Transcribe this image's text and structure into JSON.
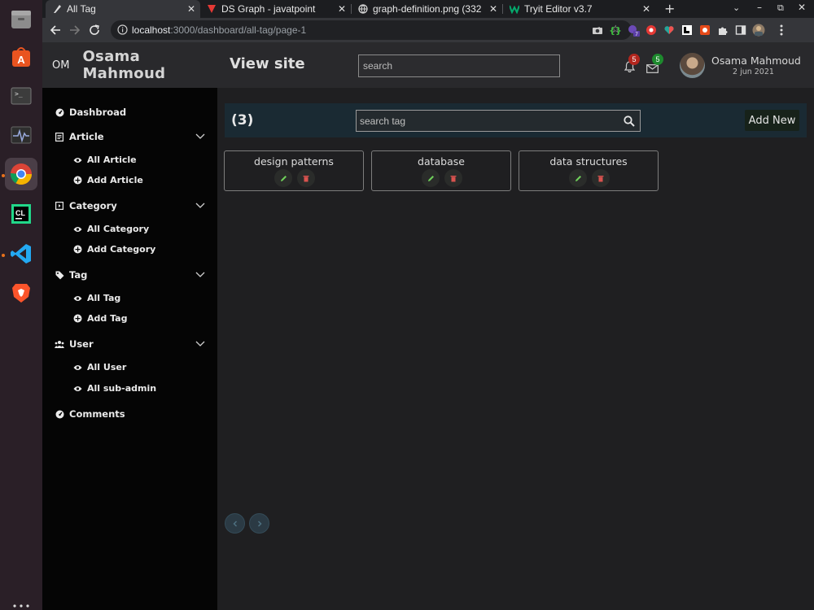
{
  "browser": {
    "tabs": [
      {
        "label": "All Tag",
        "active": true
      },
      {
        "label": "DS Graph - javatpoint",
        "active": false
      },
      {
        "label": "graph-definition.png (332",
        "active": false
      },
      {
        "label": "Tryit Editor v3.7",
        "active": false
      }
    ],
    "url_host": "localhost",
    "url_path": ":3000/dashboard/all-tag/page-1"
  },
  "header": {
    "initials": "OM",
    "brand_name": "Osama Mahmoud",
    "view_site": "View site",
    "search_placeholder": "search",
    "notifications_count": "5",
    "messages_count": "5",
    "user_name": "Osama Mahmoud",
    "user_date": "2 jun 2021"
  },
  "sidebar": {
    "dashboard": "Dashbroad",
    "article": {
      "label": "Article",
      "items": [
        "All Article",
        "Add Article"
      ]
    },
    "category": {
      "label": "Category",
      "items": [
        "All Category",
        "Add Category"
      ]
    },
    "tag": {
      "label": "Tag",
      "items": [
        "All Tag",
        "Add Tag"
      ]
    },
    "user": {
      "label": "User",
      "items": [
        "All User",
        "All sub-admin"
      ]
    },
    "comments": "Comments"
  },
  "main": {
    "count": "(3)",
    "search_placeholder": "search tag",
    "add_new": "Add New",
    "tags": [
      "design patterns",
      "database",
      "data structures"
    ]
  },
  "colors": {
    "badge_red": "#b3261e",
    "badge_green": "#1e8a2e",
    "edit_green": "#6fcf5a",
    "delete_red": "#d9534f"
  }
}
